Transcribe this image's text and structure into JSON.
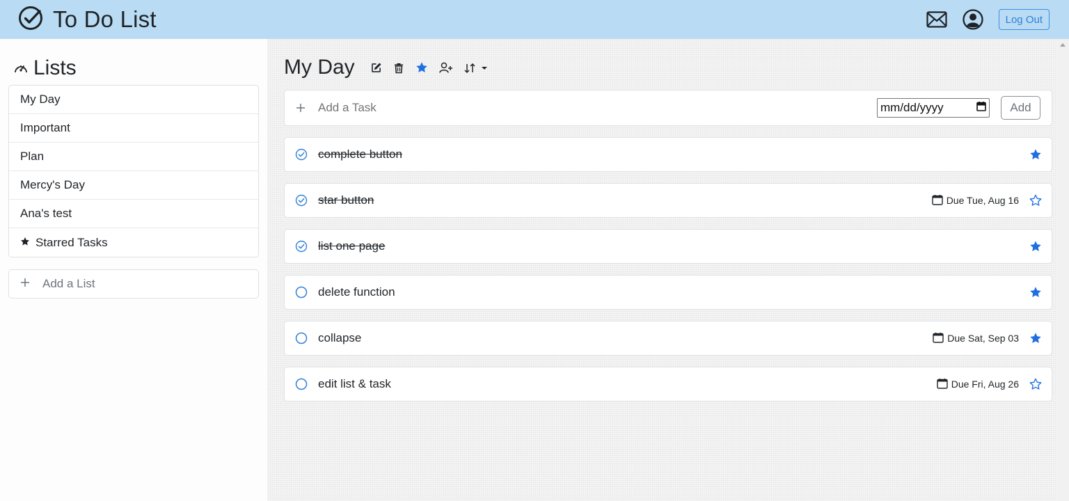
{
  "app": {
    "title": "To Do List",
    "logout_label": "Log Out"
  },
  "icons": {
    "brand": "check-circle-icon",
    "mail": "envelope-icon",
    "profile": "user-circle-icon"
  },
  "colors": {
    "navbar": "#b9dcf4",
    "accent": "#1f6fe0"
  },
  "sidebar": {
    "title": "Lists",
    "items": [
      {
        "label": "My Day"
      },
      {
        "label": "Important"
      },
      {
        "label": "Plan"
      },
      {
        "label": "Mercy's Day"
      },
      {
        "label": "Ana's test"
      },
      {
        "label": "Starred Tasks",
        "icon": "star-icon"
      }
    ],
    "add_list_placeholder": "Add a List"
  },
  "main": {
    "title": "My Day",
    "toolbar": [
      "edit-icon",
      "trash-icon",
      "star-icon",
      "add-user-icon",
      "sort-icon"
    ],
    "add_task": {
      "placeholder": "Add a Task",
      "date_placeholder": "mm/dd/yyyy",
      "add_label": "Add"
    },
    "tasks": [
      {
        "title": "complete button",
        "completed": true,
        "due": "",
        "starred": true
      },
      {
        "title": "star button",
        "completed": true,
        "due": "Due Tue, Aug 16",
        "starred": false
      },
      {
        "title": "list one page",
        "completed": true,
        "due": "",
        "starred": true
      },
      {
        "title": "delete function",
        "completed": false,
        "due": "",
        "starred": true
      },
      {
        "title": "collapse",
        "completed": false,
        "due": "Due Sat, Sep 03",
        "starred": true
      },
      {
        "title": "edit list & task",
        "completed": false,
        "due": "Due Fri, Aug 26",
        "starred": false
      }
    ]
  }
}
